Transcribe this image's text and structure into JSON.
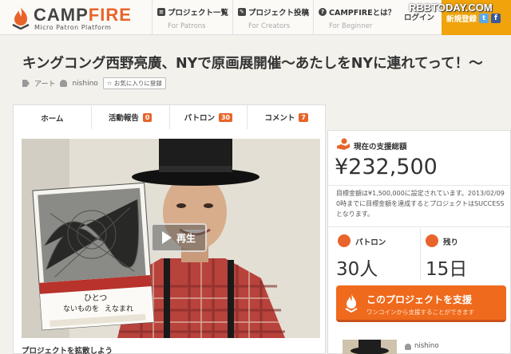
{
  "header": {
    "logo_text_camp": "CAMP",
    "logo_text_fire": "FIRE",
    "logo_tagline": "Micro Patron Platform",
    "nav": [
      {
        "label": "プロジェクト一覧",
        "sub": "For Patrons",
        "icon": "list-icon"
      },
      {
        "label": "プロジェクト投稿",
        "sub": "For Creators",
        "icon": "post-icon"
      },
      {
        "label": "CAMPFIREとは？",
        "sub": "For Beginner",
        "icon": "help-icon"
      }
    ],
    "login": "ログイン",
    "register": "新規登録",
    "social": {
      "twitter": "t",
      "facebook": "f"
    },
    "watermark": "RBBTODAY.COM"
  },
  "project": {
    "title": "キングコング西野亮廣、NYで原画展開催～あたしをNYに連れてって！～",
    "category": "アート",
    "owner": "nishino",
    "favorite_button": "☆ お気に入りに登録"
  },
  "tabs": [
    {
      "label": "ホーム",
      "badge": ""
    },
    {
      "label": "活動報告",
      "badge": "0"
    },
    {
      "label": "パトロン",
      "badge": "30"
    },
    {
      "label": "コメント",
      "badge": "7"
    }
  ],
  "video": {
    "play_label": "再生",
    "book_text": [
      "ひとつ",
      "ないものを",
      "えなまれ"
    ]
  },
  "spread_label": "プロジェクトを拡散しよう",
  "sidebar": {
    "funds_label": "現在の支援総額",
    "funds_value": "¥232,500",
    "goal_text": "目標金額は¥1,500,000に設定されています。2013/02/09 0時までに目標金額を達成するとプロジェクトはSUCCESSとなります。",
    "patrons_label": "パトロン",
    "patrons_value": "30人",
    "remaining_label": "残り",
    "remaining_value": "15日",
    "support_label": "このプロジェクトを支援",
    "support_sub": "ワンコインから支援することができます",
    "owner_name": "nishino"
  },
  "colors": {
    "brand_orange": "#e8642a",
    "register_yellow": "#f0a30a",
    "support_orange": "#ef6a1c"
  }
}
